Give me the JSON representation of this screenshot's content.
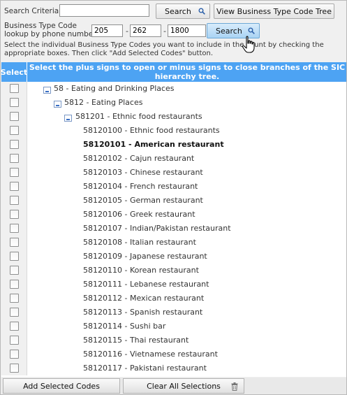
{
  "search": {
    "criteria_label": "Search Criteria:",
    "criteria_value": "",
    "search_button": "Search",
    "view_tree_button": "View Business Type Code Tree"
  },
  "phone": {
    "label_line1": "Business Type Code",
    "label_line2": "lookup by phone number:",
    "area": "205",
    "prefix": "262",
    "line": "1800",
    "sep": "-",
    "search_button": "Search"
  },
  "instructions": {
    "line1": "Select the individual Business Type Codes you want to include in the count by checking the",
    "line2": "appropriate boxes. Then click \"Add Selected Codes\" button."
  },
  "grid": {
    "select_header": "Select",
    "message_line1": "Select the plus signs to open or minus signs to close branches of the SIC",
    "message_line2": "hierarchy tree.",
    "rows": [
      {
        "label": "58 - Eating and Drinking Places",
        "toggle": "minus",
        "bold": false
      },
      {
        "label": "5812 - Eating Places",
        "toggle": "minus",
        "bold": false
      },
      {
        "label": "581201 - Ethnic food restaurants",
        "toggle": "minus",
        "bold": false
      },
      {
        "label": "58120100 - Ethnic food restaurants",
        "toggle": "none",
        "bold": false
      },
      {
        "label": "58120101 - American restaurant",
        "toggle": "none",
        "bold": true
      },
      {
        "label": "58120102 - Cajun restaurant",
        "toggle": "none",
        "bold": false
      },
      {
        "label": "58120103 - Chinese restaurant",
        "toggle": "none",
        "bold": false
      },
      {
        "label": "58120104 - French restaurant",
        "toggle": "none",
        "bold": false
      },
      {
        "label": "58120105 - German restaurant",
        "toggle": "none",
        "bold": false
      },
      {
        "label": "58120106 - Greek restaurant",
        "toggle": "none",
        "bold": false
      },
      {
        "label": "58120107 - Indian/Pakistan restaurant",
        "toggle": "none",
        "bold": false
      },
      {
        "label": "58120108 - Italian restaurant",
        "toggle": "none",
        "bold": false
      },
      {
        "label": "58120109 - Japanese restaurant",
        "toggle": "none",
        "bold": false
      },
      {
        "label": "58120110 - Korean restaurant",
        "toggle": "none",
        "bold": false
      },
      {
        "label": "58120111 - Lebanese restaurant",
        "toggle": "none",
        "bold": false
      },
      {
        "label": "58120112 - Mexican restaurant",
        "toggle": "none",
        "bold": false
      },
      {
        "label": "58120113 - Spanish restaurant",
        "toggle": "none",
        "bold": false
      },
      {
        "label": "58120114 - Sushi bar",
        "toggle": "none",
        "bold": false
      },
      {
        "label": "58120115 - Thai restaurant",
        "toggle": "none",
        "bold": false
      },
      {
        "label": "58120116 - Vietnamese restaurant",
        "toggle": "none",
        "bold": false
      },
      {
        "label": "58120117 - Pakistani restaurant",
        "toggle": "none",
        "bold": false
      }
    ]
  },
  "footer": {
    "add_button": "Add Selected Codes",
    "clear_button": "Clear All Selections"
  },
  "icons": {
    "search": "magnifier-icon",
    "trash": "trash-icon",
    "cursor": "hand-pointer-icon"
  },
  "colors": {
    "header_bg": "#4da3f3",
    "highlight_button": "#a9d3f3"
  }
}
